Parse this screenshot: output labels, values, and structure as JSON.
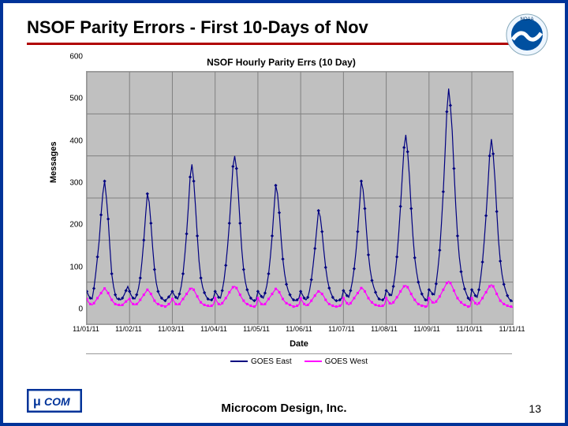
{
  "title": "NSOF Parity Errors - First 10-Days of Nov",
  "footer": "Microcom Design, Inc.",
  "page": "13",
  "chart_data": {
    "type": "line",
    "title": "NSOF Hourly Parity Errs (10 Day)",
    "xlabel": "Date",
    "ylabel": "Messages",
    "ylim": [
      0,
      600
    ],
    "xticks": [
      "11/01/11",
      "11/02/11",
      "11/03/11",
      "11/04/11",
      "11/05/11",
      "11/06/11",
      "11/07/11",
      "11/08/11",
      "11/09/11",
      "11/10/11",
      "11/11/11"
    ],
    "yticks": [
      0,
      100,
      200,
      300,
      400,
      500,
      600
    ],
    "legend": [
      "GOES East",
      "GOES West"
    ],
    "colors": {
      "GOES East": "#000080",
      "GOES West": "#ff00ff"
    },
    "series": [
      {
        "name": "GOES East",
        "color": "#000080",
        "values": [
          78,
          68,
          62,
          60,
          85,
          120,
          160,
          200,
          260,
          310,
          340,
          300,
          250,
          180,
          120,
          90,
          70,
          60,
          60,
          58,
          62,
          70,
          80,
          90,
          78,
          68,
          62,
          60,
          70,
          85,
          110,
          150,
          200,
          260,
          310,
          290,
          240,
          180,
          130,
          98,
          78,
          68,
          62,
          58,
          56,
          60,
          65,
          70,
          78,
          70,
          64,
          60,
          72,
          90,
          120,
          165,
          215,
          280,
          350,
          380,
          340,
          280,
          210,
          150,
          110,
          88,
          75,
          66,
          60,
          58,
          58,
          62,
          78,
          72,
          64,
          62,
          80,
          105,
          140,
          185,
          240,
          305,
          375,
          400,
          370,
          310,
          240,
          175,
          130,
          100,
          82,
          70,
          62,
          58,
          56,
          58,
          78,
          72,
          66,
          62,
          74,
          92,
          120,
          160,
          210,
          270,
          330,
          310,
          265,
          205,
          155,
          120,
          95,
          80,
          70,
          62,
          58,
          56,
          58,
          62,
          78,
          70,
          62,
          58,
          64,
          80,
          106,
          140,
          180,
          226,
          270,
          255,
          220,
          175,
          135,
          106,
          86,
          74,
          64,
          58,
          56,
          56,
          58,
          62,
          80,
          74,
          68,
          64,
          80,
          102,
          132,
          172,
          220,
          280,
          340,
          320,
          275,
          218,
          165,
          130,
          104,
          88,
          76,
          66,
          60,
          58,
          58,
          62,
          80,
          76,
          70,
          68,
          90,
          120,
          160,
          215,
          280,
          350,
          420,
          450,
          410,
          350,
          275,
          208,
          158,
          125,
          100,
          84,
          72,
          64,
          58,
          56,
          82,
          78,
          72,
          70,
          96,
          132,
          176,
          240,
          315,
          405,
          505,
          560,
          520,
          460,
          370,
          282,
          210,
          160,
          125,
          102,
          84,
          72,
          62,
          56,
          82,
          76,
          68,
          64,
          82,
          110,
          148,
          198,
          258,
          326,
          400,
          440,
          405,
          345,
          268,
          200,
          150,
          118,
          95,
          80,
          68,
          60,
          56,
          54
        ]
      },
      {
        "name": "GOES West",
        "color": "#ff00ff",
        "values": [
          60,
          52,
          48,
          46,
          50,
          56,
          62,
          68,
          74,
          80,
          85,
          80,
          74,
          66,
          58,
          52,
          48,
          46,
          46,
          44,
          46,
          50,
          54,
          58,
          60,
          52,
          48,
          46,
          48,
          52,
          58,
          64,
          70,
          76,
          82,
          78,
          72,
          64,
          56,
          50,
          48,
          46,
          44,
          44,
          42,
          44,
          48,
          52,
          60,
          54,
          48,
          46,
          48,
          54,
          60,
          66,
          72,
          78,
          84,
          86,
          82,
          74,
          66,
          58,
          52,
          48,
          46,
          44,
          44,
          42,
          44,
          46,
          62,
          54,
          48,
          46,
          50,
          56,
          62,
          68,
          76,
          82,
          88,
          90,
          86,
          78,
          70,
          62,
          56,
          50,
          48,
          46,
          44,
          42,
          42,
          44,
          62,
          54,
          48,
          46,
          48,
          54,
          60,
          66,
          72,
          78,
          84,
          82,
          76,
          68,
          60,
          54,
          50,
          48,
          46,
          44,
          42,
          42,
          44,
          46,
          62,
          54,
          48,
          44,
          46,
          50,
          56,
          62,
          68,
          74,
          78,
          76,
          72,
          66,
          58,
          52,
          48,
          46,
          44,
          42,
          42,
          42,
          44,
          46,
          62,
          56,
          50,
          46,
          50,
          56,
          62,
          68,
          74,
          80,
          86,
          84,
          78,
          70,
          62,
          56,
          52,
          48,
          46,
          44,
          44,
          42,
          44,
          46,
          62,
          56,
          50,
          48,
          52,
          58,
          64,
          70,
          78,
          84,
          90,
          92,
          88,
          80,
          72,
          64,
          58,
          52,
          48,
          46,
          44,
          44,
          42,
          42,
          62,
          58,
          52,
          50,
          54,
          60,
          66,
          74,
          82,
          90,
          98,
          102,
          98,
          90,
          80,
          70,
          62,
          56,
          52,
          48,
          46,
          44,
          42,
          42,
          62,
          56,
          50,
          46,
          50,
          56,
          62,
          70,
          76,
          84,
          90,
          94,
          90,
          82,
          72,
          64,
          56,
          52,
          48,
          46,
          44,
          42,
          42,
          40
        ]
      }
    ]
  }
}
